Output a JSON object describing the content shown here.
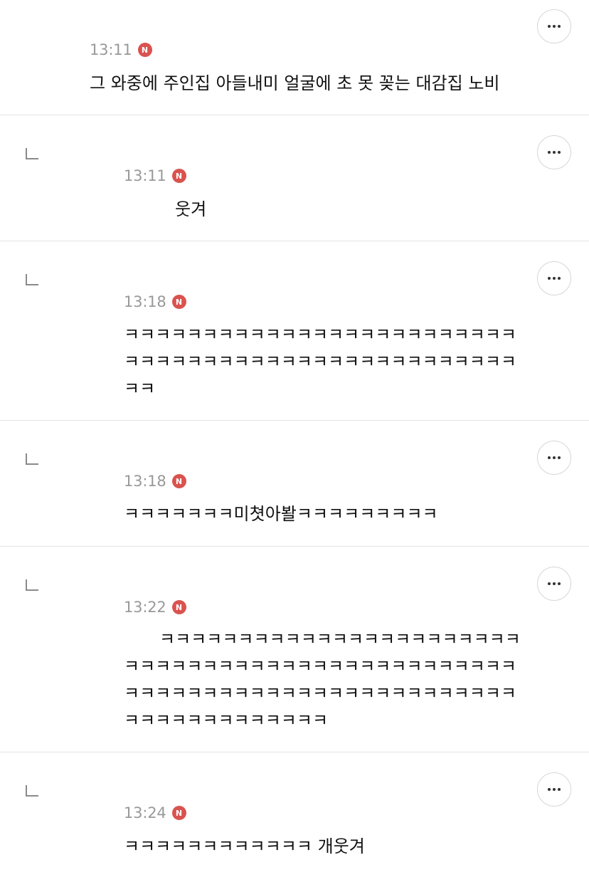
{
  "comments": [
    {
      "time": "13:11",
      "badge": "N",
      "lines": [
        "그 와중에 주인집 아들내미 얼굴에 초 못 꽂는 대감집 노비"
      ]
    },
    {
      "time": "13:11",
      "badge": "N",
      "lines": [
        "웃겨"
      ]
    },
    {
      "time": "13:18",
      "badge": "N",
      "lines": [
        "ㅋㅋㅋㅋㅋㅋㅋㅋㅋㅋㅋㅋㅋㅋㅋㅋㅋㅋㅋㅋㅋㅋㅋㅋㅋ",
        "ㅋㅋㅋㅋㅋㅋㅋㅋㅋㅋㅋㅋㅋㅋㅋㅋㅋㅋㅋㅋㅋㅋㅋㅋㅋ",
        "ㅋㅋ"
      ]
    },
    {
      "time": "13:18",
      "badge": "N",
      "lines": [
        "ㅋㅋㅋㅋㅋㅋㅋ미쳣아봘ㅋㅋㅋㅋㅋㅋㅋㅋㅋ"
      ]
    },
    {
      "time": "13:22",
      "badge": "N",
      "lines": [
        "ㅋㅋㅋㅋㅋㅋㅋㅋㅋㅋㅋㅋㅋㅋㅋㅋㅋㅋㅋㅋㅋㅋㅋ",
        "ㅋㅋㅋㅋㅋㅋㅋㅋㅋㅋㅋㅋㅋㅋㅋㅋㅋㅋㅋㅋㅋㅋㅋㅋㅋ",
        "ㅋㅋㅋㅋㅋㅋㅋㅋㅋㅋㅋㅋㅋㅋㅋㅋㅋㅋㅋㅋㅋㅋㅋㅋㅋ",
        "ㅋㅋㅋㅋㅋㅋㅋㅋㅋㅋㅋㅋㅋ"
      ]
    },
    {
      "time": "13:24",
      "badge": "N",
      "lines": [
        "ㅋㅋㅋㅋㅋㅋㅋㅋㅋㅋㅋㅋ 개웃겨"
      ]
    }
  ],
  "icons": {
    "reply": "reply-arrow-icon",
    "more": "more-options-icon",
    "badge": "new-badge-icon"
  },
  "colors": {
    "badge": "#d9534f",
    "time": "#999999",
    "divider": "#e3e3e3"
  }
}
